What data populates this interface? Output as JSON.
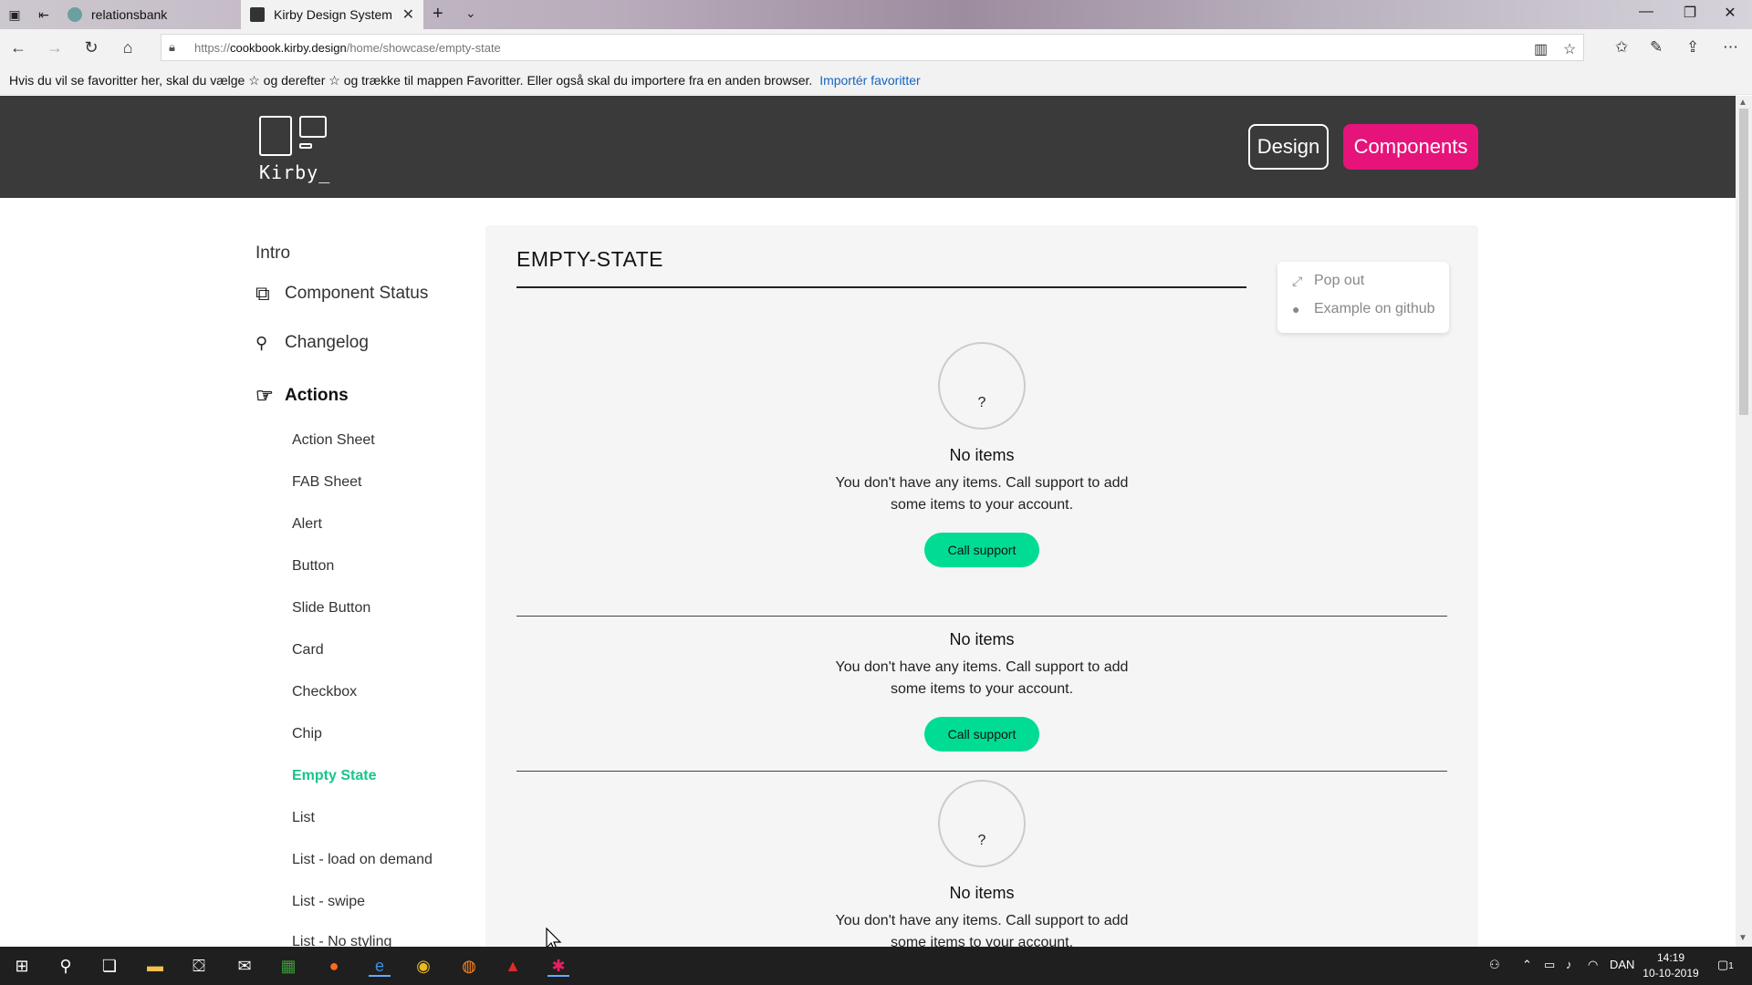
{
  "browser": {
    "tabs": [
      {
        "label": "relationsbank",
        "active": false
      },
      {
        "label": "Kirby Design System",
        "active": true
      }
    ],
    "url_prefix": "https://",
    "url_host": "cookbook.kirby.design",
    "url_path": "/home/showcase/empty-state",
    "favbar_text": "Hvis du vil se favoritter her, skal du vælge  ☆  og derefter ☆ og trække til mappen Favoritter. Eller også skal du importere fra en anden browser.",
    "favbar_link": "Importér favoritter"
  },
  "header": {
    "logo_text": "Kirby_",
    "design_label": "Design",
    "components_label": "Components",
    "accent": "#e6137a"
  },
  "sidebar": {
    "top_items": [
      {
        "label": "Intro"
      },
      {
        "label": "Component Status"
      },
      {
        "label": "Changelog"
      },
      {
        "label": "Actions"
      }
    ],
    "sub_items": [
      "Action Sheet",
      "FAB Sheet",
      "Alert",
      "Button",
      "Slide Button",
      "Card",
      "Checkbox",
      "Chip",
      "Empty State",
      "List",
      "List - load on demand",
      "List - swipe",
      "List - No styling"
    ],
    "active_sub": "Empty State",
    "active_color": "#18c48a"
  },
  "content": {
    "title": "EMPTY-STATE",
    "popout_label": "Pop out",
    "github_label": "Example on github",
    "examples": [
      {
        "icon": "?",
        "title": "No items",
        "desc": "You don't have any items. Call support to add some items to your account.",
        "button": "Call support"
      },
      {
        "title": "No items",
        "desc": "You don't have any items. Call support to add some items to your account.",
        "button": "Call support"
      },
      {
        "icon": "?",
        "title": "No items",
        "desc": "You don't have any items. Call support to add some items to your account."
      }
    ],
    "button_color": "#00dc93"
  },
  "taskbar": {
    "language": "DAN",
    "time": "14:19",
    "date": "10-10-2019",
    "notification_count": "1"
  }
}
